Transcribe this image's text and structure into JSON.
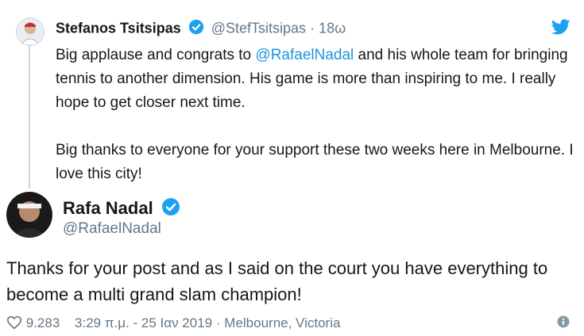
{
  "quoted_tweet": {
    "author_name": "Stefanos Tsitsipas",
    "handle": "@StefTsitsipas",
    "separator": "·",
    "time": "18ω",
    "text_part1": "Big applause and congrats to ",
    "mention": "@RafaelNadal",
    "text_part2": " and his whole team for bringing tennis to another dimension. His game is more than inspiring to me. I really hope to get closer next time.",
    "text_para2": "Big thanks to everyone for your support these two weeks here in Melbourne. I love this city!"
  },
  "reply_tweet": {
    "author_name": "Rafa Nadal",
    "handle": "@RafaelNadal",
    "text": "Thanks for your post and as I said on the court you have everything to become a multi grand slam champion!",
    "likes": "9.283",
    "timestamp": "3:29 π.μ. - 25 Ιαν 2019",
    "dot": "·",
    "location": "Melbourne, Victoria"
  },
  "icons": {
    "brand": "twitter-bird-icon",
    "verified": "verified-badge-icon",
    "like": "heart-icon",
    "info": "info-icon"
  },
  "colors": {
    "link": "#1b95e0",
    "verified": "#1da1f2",
    "muted": "#657786",
    "text": "#14171a",
    "thread_line": "#ccd6dd"
  }
}
